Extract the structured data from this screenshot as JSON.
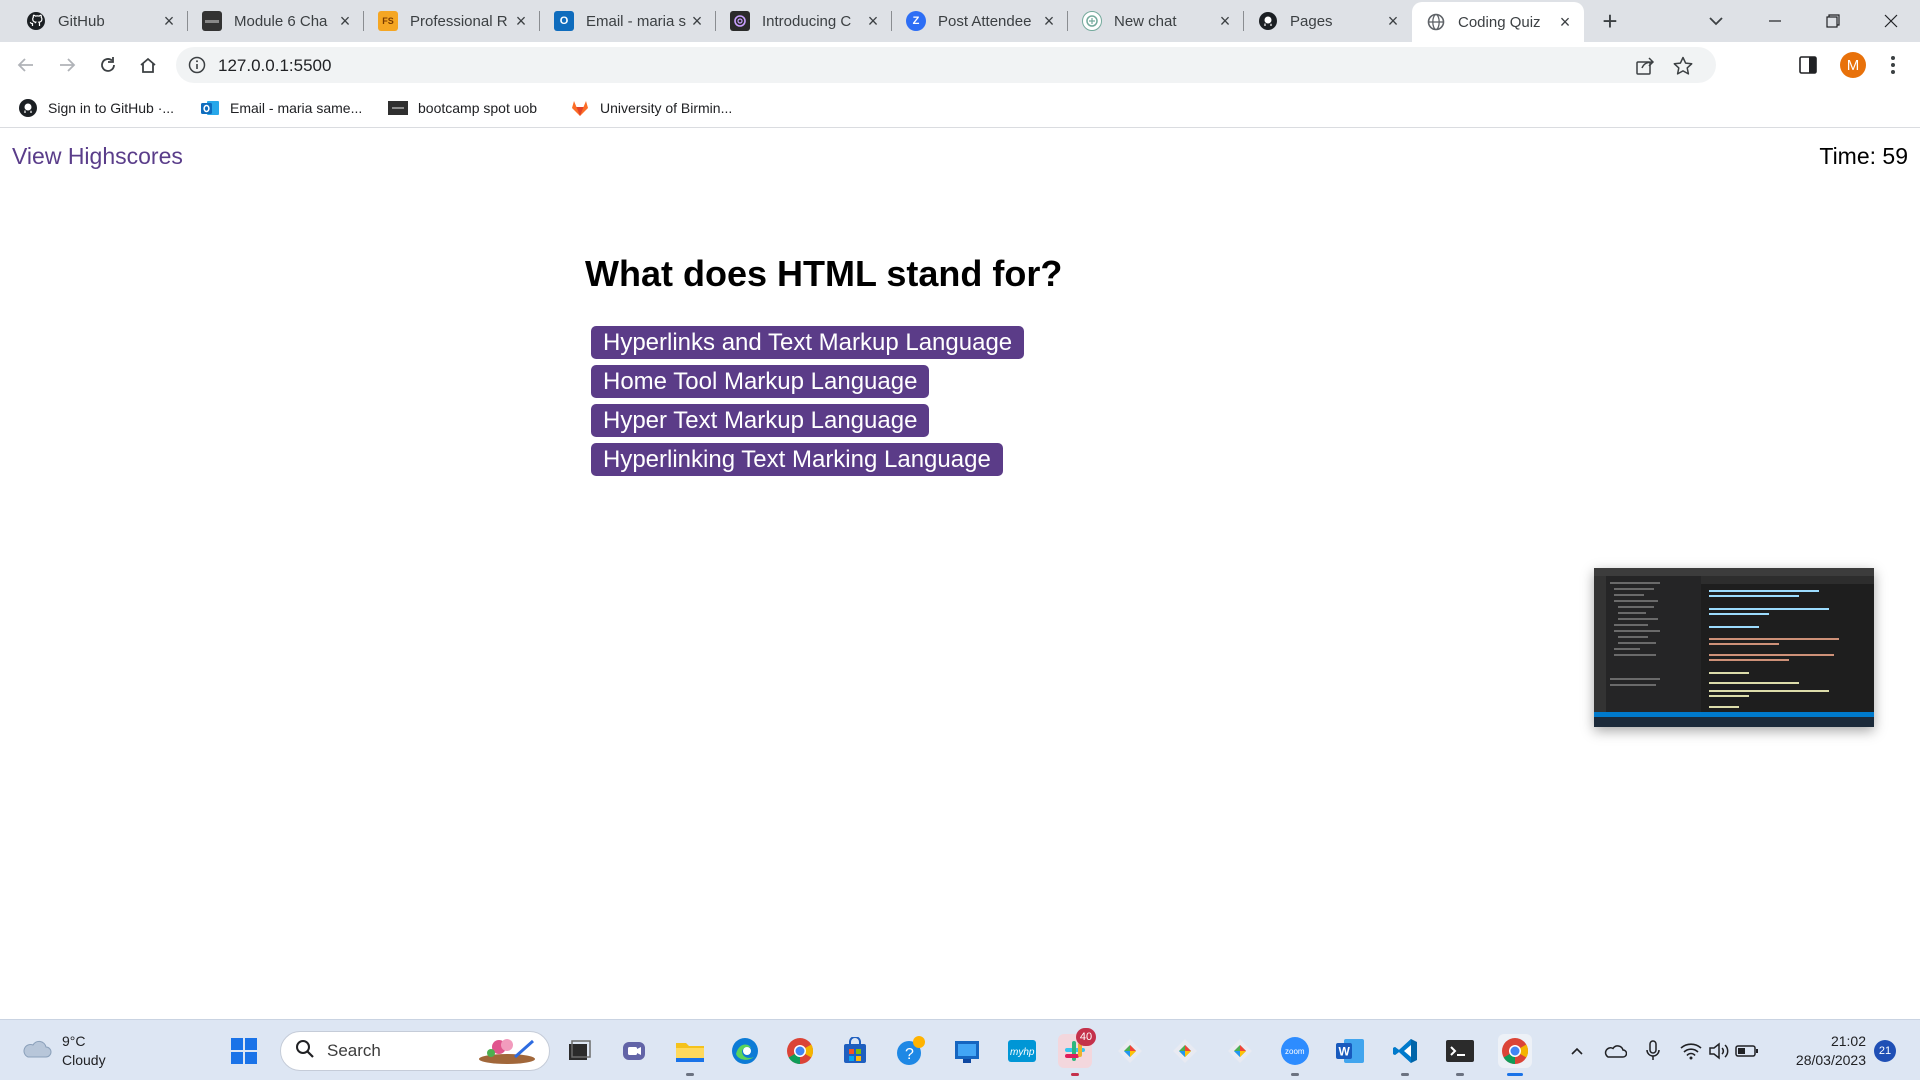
{
  "browser": {
    "tabs": [
      {
        "title": "GitHub",
        "icon": "github-icon",
        "active": false
      },
      {
        "title": "Module 6 Cha",
        "icon": "bootcamp-icon",
        "active": false
      },
      {
        "title": "Professional R",
        "icon": "fs-icon",
        "active": false
      },
      {
        "title": "Email - maria s",
        "icon": "outlook-icon",
        "active": false
      },
      {
        "title": "Introducing C",
        "icon": "openai-icon",
        "active": false
      },
      {
        "title": "Post Attendee",
        "icon": "zoom-icon",
        "active": false
      },
      {
        "title": "New chat",
        "icon": "chatgpt-icon",
        "active": false
      },
      {
        "title": "Pages",
        "icon": "github-icon",
        "active": false
      },
      {
        "title": "Coding Quiz",
        "icon": "globe-icon",
        "active": true
      }
    ],
    "url": "127.0.0.1:5500",
    "profile_initial": "M",
    "profile_color": "#e8710a",
    "bookmarks": [
      {
        "label": "Sign in to GitHub ·...",
        "icon": "github-icon"
      },
      {
        "label": "Email - maria same...",
        "icon": "outlook-icon"
      },
      {
        "label": "bootcamp spot uob",
        "icon": "bootcamp-icon"
      },
      {
        "label": "University of Birmin...",
        "icon": "gitlab-icon"
      }
    ]
  },
  "quiz": {
    "highscores_link": "View Highscores",
    "timer": "Time: 59",
    "question": "What does HTML stand for?",
    "choices": [
      "Hyperlinks and Text Markup Language",
      "Home Tool Markup Language",
      "Hyper Text Markup Language",
      "Hyperlinking Text Marking Language"
    ],
    "accent_color": "#5b3c88",
    "link_color": "#5a3d8a"
  },
  "taskbar": {
    "weather_temp": "9°C",
    "weather_desc": "Cloudy",
    "search_label": "Search",
    "clock_time": "21:02",
    "clock_date": "28/03/2023",
    "notification_count": "21",
    "slack_badge": "40"
  }
}
